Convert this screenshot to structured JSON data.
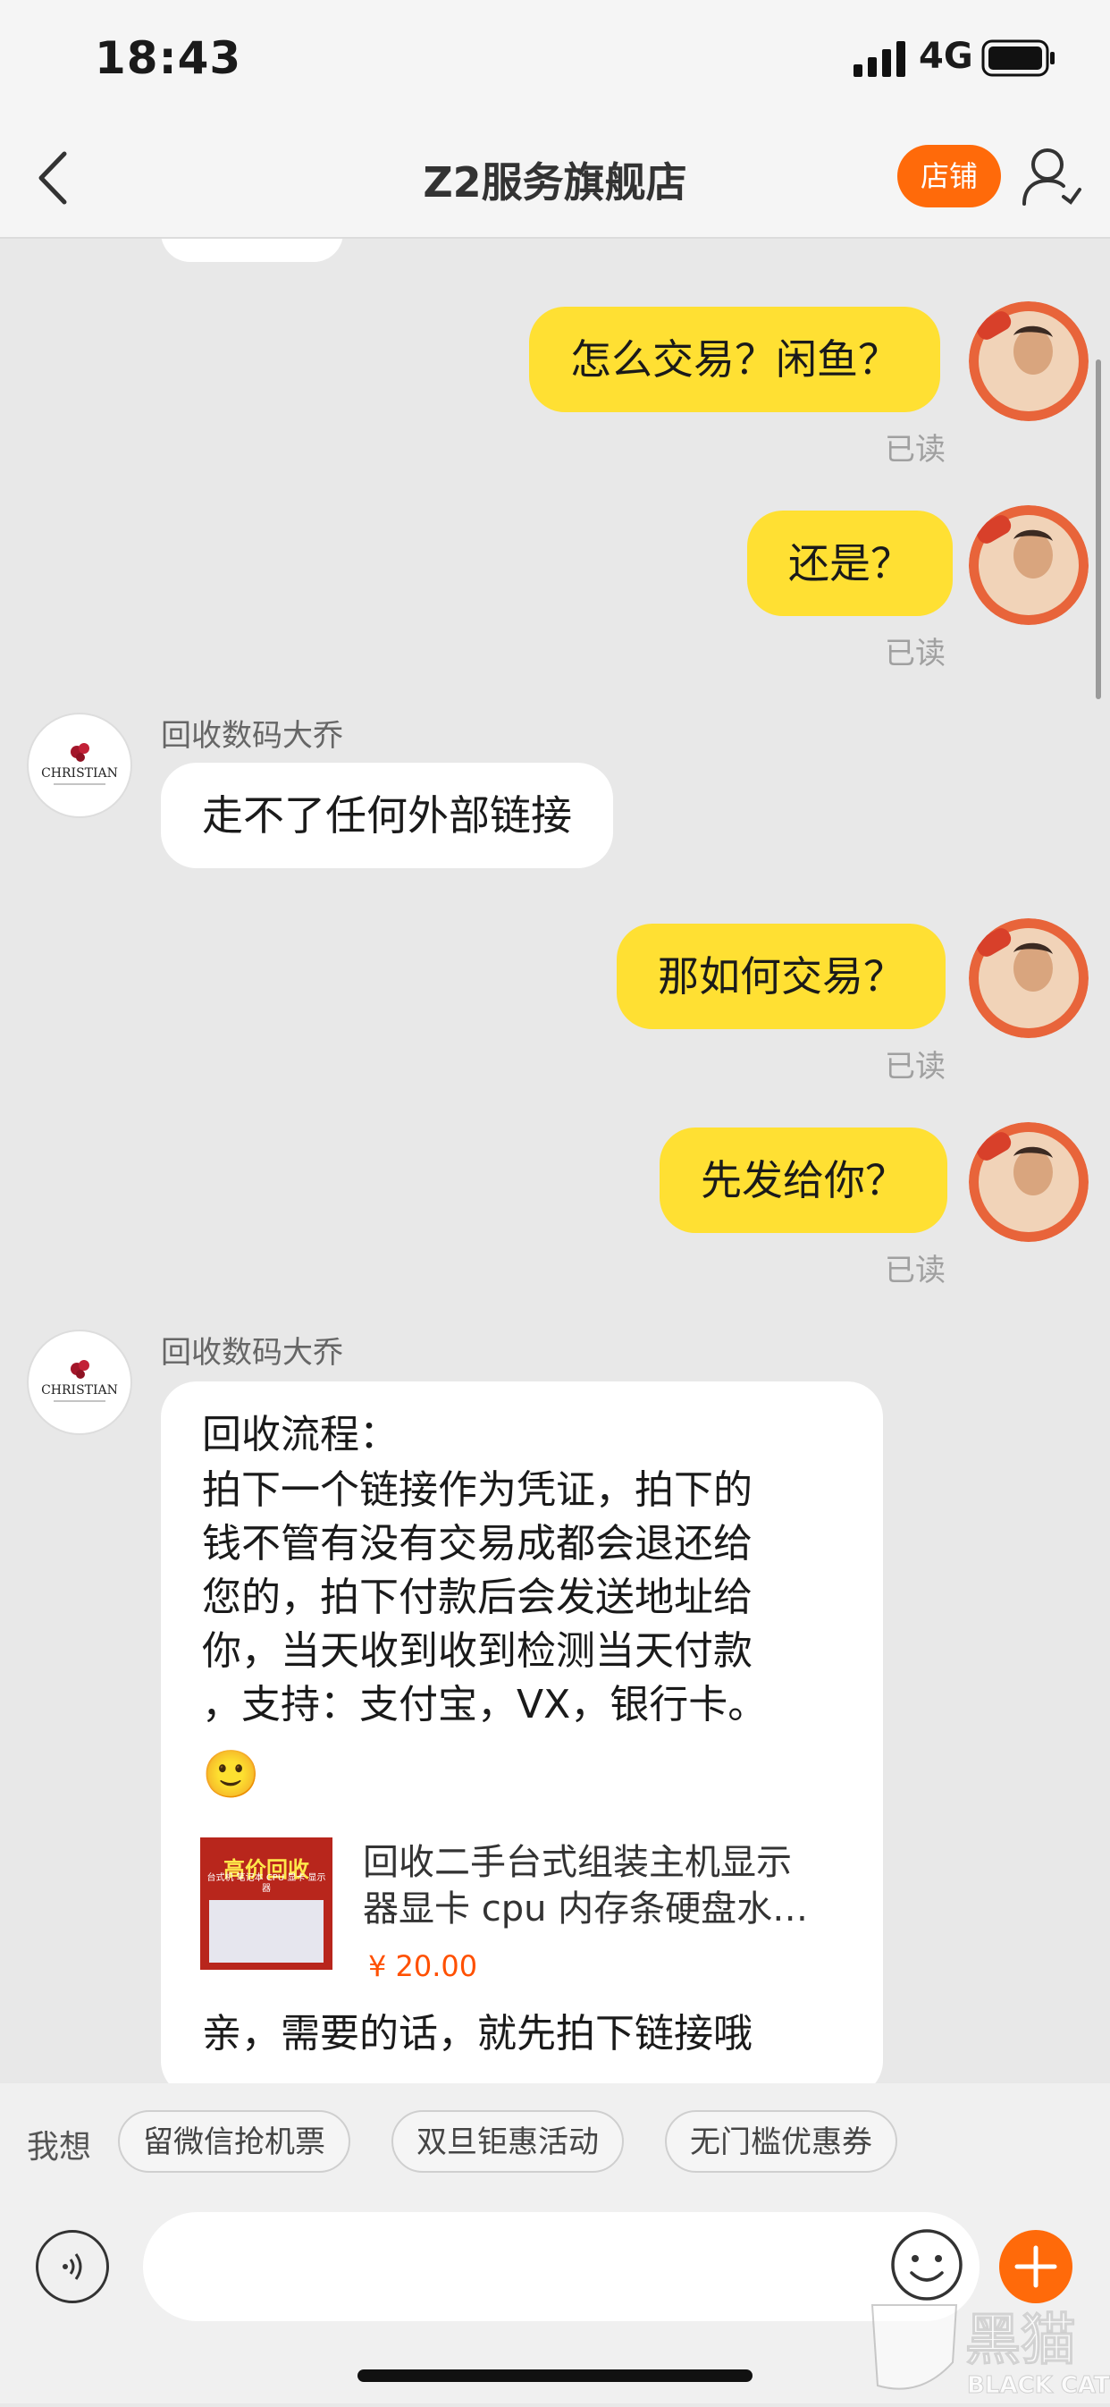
{
  "status_bar": {
    "time": "18:43",
    "network": "4G"
  },
  "nav": {
    "title": "Z2服务旗舰店",
    "store_label": "店铺"
  },
  "messages": [
    {
      "dir": "out",
      "text": "怎么交易？闲鱼？",
      "status": "已读"
    },
    {
      "dir": "out",
      "text": "还是？",
      "status": "已读"
    },
    {
      "dir": "in",
      "sender": "回收数码大乔",
      "text": "走不了任何外部链接"
    },
    {
      "dir": "out",
      "text": "那如何交易？",
      "status": "已读"
    },
    {
      "dir": "out",
      "text": "先发给你？",
      "status": "已读"
    },
    {
      "dir": "in",
      "sender": "回收数码大乔",
      "lines": [
        "回收流程：",
        "拍下一个链接作为凭证，拍下的",
        "钱不管有没有交易成都会退还给",
        "您的，拍下付款后会发送地址给",
        "你，当天收到收到检测当天付款",
        "，支持：支付宝，VX，银行卡。"
      ],
      "emoji": "🙂",
      "product": {
        "badge": "高价回收",
        "subbadge": "台式机 笔记本 CPU 显卡 显示器",
        "title_line1": "回收二手台式组装主机显示",
        "title_line2": "器显卡 cpu 内存条硬盘水…",
        "price": "¥ 20.00"
      },
      "footer": "亲，需要的话，就先拍下链接哦"
    }
  ],
  "other_avatar_text": "CHRISTIAN",
  "quick_replies": {
    "label": "我想",
    "chips": [
      "留微信抢机票",
      "双旦钜惠活动",
      "无门槛优惠券"
    ]
  },
  "input": {
    "placeholder": ""
  },
  "watermark": {
    "cn": "黑猫",
    "en": "BLACK CAT"
  },
  "colors": {
    "accent": "#ff6a0a",
    "bubble_out": "#ffe033",
    "bubble_in": "#ffffff",
    "price": "#ff5000"
  }
}
